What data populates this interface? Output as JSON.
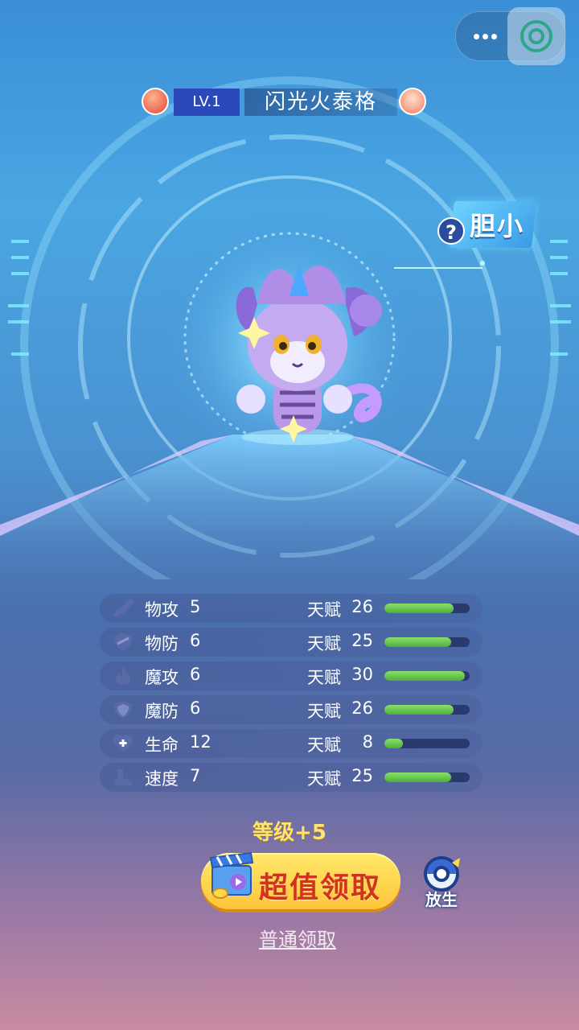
{
  "header": {
    "level_label": "LV.1",
    "pet_name": "闪光火泰格",
    "element_icon": "fire-element-icon",
    "race_icon": "beast-race-icon"
  },
  "trait": {
    "help_mark": "?",
    "label": "胆小"
  },
  "stats": [
    {
      "icon": "sword-icon",
      "label": "物攻",
      "value": "5",
      "talent_label": "天赋",
      "talent": "26",
      "fill": 0.81
    },
    {
      "icon": "shield-icon",
      "label": "物防",
      "value": "6",
      "talent_label": "天赋",
      "talent": "25",
      "fill": 0.78
    },
    {
      "icon": "flame-icon",
      "label": "魔攻",
      "value": "6",
      "talent_label": "天赋",
      "talent": "30",
      "fill": 0.94
    },
    {
      "icon": "magic-shield-icon",
      "label": "魔防",
      "value": "6",
      "talent_label": "天赋",
      "talent": "26",
      "fill": 0.81
    },
    {
      "icon": "heart-plus-icon",
      "label": "生命",
      "value": "12",
      "talent_label": "天赋",
      "talent": "8",
      "fill": 0.22
    },
    {
      "icon": "boot-icon",
      "label": "速度",
      "value": "7",
      "talent_label": "天赋",
      "talent": "25",
      "fill": 0.78
    }
  ],
  "reward": {
    "level_bonus": "等级+5",
    "claim_button": "超值领取",
    "release_label": "放生",
    "normal_claim": "普通领取"
  },
  "colors": {
    "accent": "#ffc53a",
    "claim_text": "#d0341e",
    "bar_fill": "#4cb03a",
    "bonus_text": "#ffe36a"
  }
}
